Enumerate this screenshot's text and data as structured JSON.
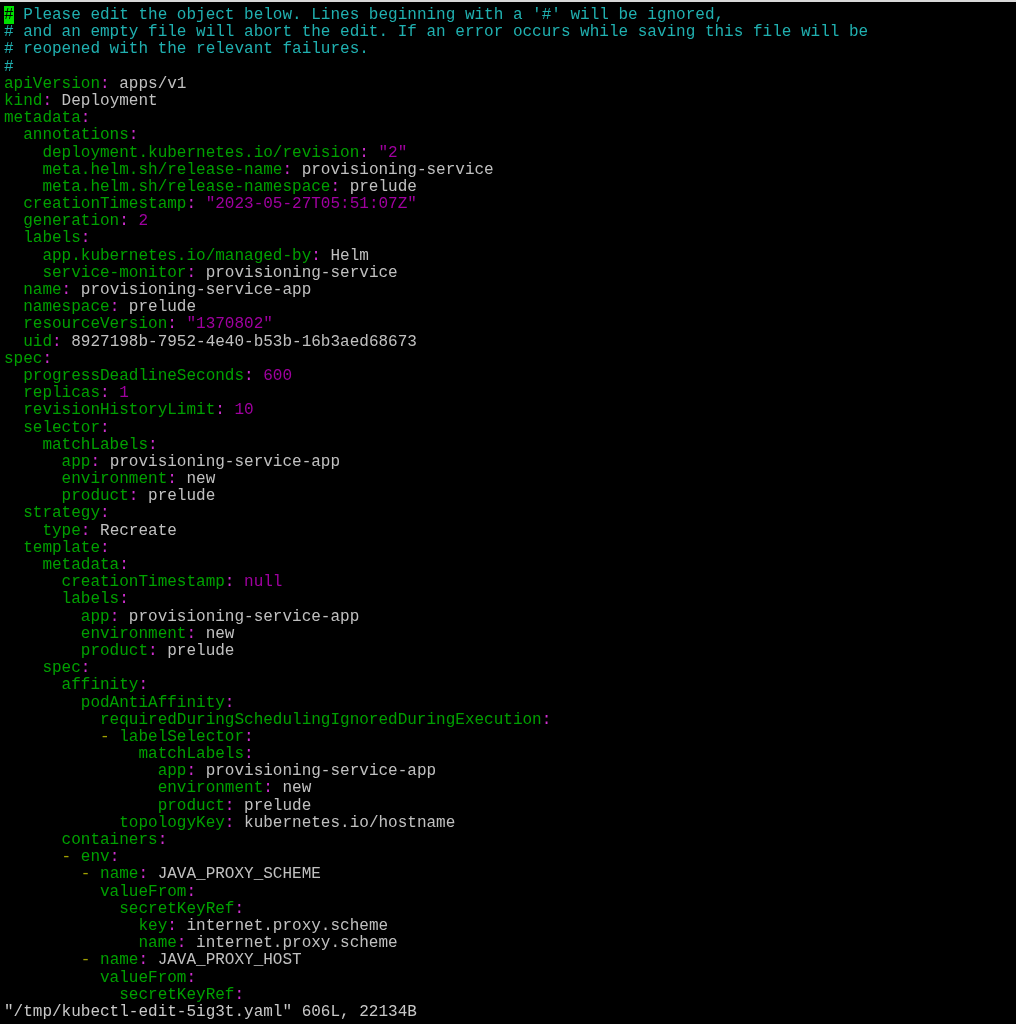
{
  "editor": {
    "lines": [
      {
        "parts": [
          {
            "kind": "cursor",
            "text": "#"
          },
          {
            "kind": "comment",
            "text": " Please edit the object below. Lines beginning with a '#' will be ignored,"
          }
        ]
      },
      {
        "parts": [
          {
            "kind": "comment",
            "text": "# and an empty file will abort the edit. If an error occurs while saving this file will be"
          }
        ]
      },
      {
        "parts": [
          {
            "kind": "comment",
            "text": "# reopened with the relevant failures."
          }
        ]
      },
      {
        "parts": [
          {
            "kind": "comment",
            "text": "#"
          }
        ]
      },
      {
        "parts": [
          {
            "kind": "key",
            "text": "apiVersion"
          },
          {
            "kind": "punct",
            "text": ":"
          },
          {
            "kind": "value",
            "text": " apps/v1"
          }
        ]
      },
      {
        "parts": [
          {
            "kind": "key",
            "text": "kind"
          },
          {
            "kind": "punct",
            "text": ":"
          },
          {
            "kind": "value",
            "text": " Deployment"
          }
        ]
      },
      {
        "parts": [
          {
            "kind": "key",
            "text": "metadata"
          },
          {
            "kind": "punct",
            "text": ":"
          }
        ]
      },
      {
        "parts": [
          {
            "kind": "key",
            "text": "  annotations"
          },
          {
            "kind": "punct",
            "text": ":"
          }
        ]
      },
      {
        "parts": [
          {
            "kind": "key",
            "text": "    deployment.kubernetes.io/revision"
          },
          {
            "kind": "punct",
            "text": ":"
          },
          {
            "kind": "literal",
            "text": " \"2\""
          }
        ]
      },
      {
        "parts": [
          {
            "kind": "key",
            "text": "    meta.helm.sh/release-name"
          },
          {
            "kind": "punct",
            "text": ":"
          },
          {
            "kind": "value",
            "text": " provisioning-service"
          }
        ]
      },
      {
        "parts": [
          {
            "kind": "key",
            "text": "    meta.helm.sh/release-namespace"
          },
          {
            "kind": "punct",
            "text": ":"
          },
          {
            "kind": "value",
            "text": " prelude"
          }
        ]
      },
      {
        "parts": [
          {
            "kind": "key",
            "text": "  creationTimestamp"
          },
          {
            "kind": "punct",
            "text": ":"
          },
          {
            "kind": "literal",
            "text": " \"2023-05-27T05:51:07Z\""
          }
        ]
      },
      {
        "parts": [
          {
            "kind": "key",
            "text": "  generation"
          },
          {
            "kind": "punct",
            "text": ":"
          },
          {
            "kind": "literal",
            "text": " 2"
          }
        ]
      },
      {
        "parts": [
          {
            "kind": "key",
            "text": "  labels"
          },
          {
            "kind": "punct",
            "text": ":"
          }
        ]
      },
      {
        "parts": [
          {
            "kind": "key",
            "text": "    app.kubernetes.io/managed-by"
          },
          {
            "kind": "punct",
            "text": ":"
          },
          {
            "kind": "value",
            "text": " Helm"
          }
        ]
      },
      {
        "parts": [
          {
            "kind": "key",
            "text": "    service-monitor"
          },
          {
            "kind": "punct",
            "text": ":"
          },
          {
            "kind": "value",
            "text": " provisioning-service"
          }
        ]
      },
      {
        "parts": [
          {
            "kind": "key",
            "text": "  name"
          },
          {
            "kind": "punct",
            "text": ":"
          },
          {
            "kind": "value",
            "text": " provisioning-service-app"
          }
        ]
      },
      {
        "parts": [
          {
            "kind": "key",
            "text": "  namespace"
          },
          {
            "kind": "punct",
            "text": ":"
          },
          {
            "kind": "value",
            "text": " prelude"
          }
        ]
      },
      {
        "parts": [
          {
            "kind": "key",
            "text": "  resourceVersion"
          },
          {
            "kind": "punct",
            "text": ":"
          },
          {
            "kind": "literal",
            "text": " \"1370802\""
          }
        ]
      },
      {
        "parts": [
          {
            "kind": "key",
            "text": "  uid"
          },
          {
            "kind": "punct",
            "text": ":"
          },
          {
            "kind": "value",
            "text": " 8927198b-7952-4e40-b53b-16b3aed68673"
          }
        ]
      },
      {
        "parts": [
          {
            "kind": "key",
            "text": "spec"
          },
          {
            "kind": "punct",
            "text": ":"
          }
        ]
      },
      {
        "parts": [
          {
            "kind": "key",
            "text": "  progressDeadlineSeconds"
          },
          {
            "kind": "punct",
            "text": ":"
          },
          {
            "kind": "literal",
            "text": " 600"
          }
        ]
      },
      {
        "parts": [
          {
            "kind": "key",
            "text": "  replicas"
          },
          {
            "kind": "punct",
            "text": ":"
          },
          {
            "kind": "literal",
            "text": " 1"
          }
        ]
      },
      {
        "parts": [
          {
            "kind": "key",
            "text": "  revisionHistoryLimit"
          },
          {
            "kind": "punct",
            "text": ":"
          },
          {
            "kind": "literal",
            "text": " 10"
          }
        ]
      },
      {
        "parts": [
          {
            "kind": "key",
            "text": "  selector"
          },
          {
            "kind": "punct",
            "text": ":"
          }
        ]
      },
      {
        "parts": [
          {
            "kind": "key",
            "text": "    matchLabels"
          },
          {
            "kind": "punct",
            "text": ":"
          }
        ]
      },
      {
        "parts": [
          {
            "kind": "key",
            "text": "      app"
          },
          {
            "kind": "punct",
            "text": ":"
          },
          {
            "kind": "value",
            "text": " provisioning-service-app"
          }
        ]
      },
      {
        "parts": [
          {
            "kind": "key",
            "text": "      environment"
          },
          {
            "kind": "punct",
            "text": ":"
          },
          {
            "kind": "value",
            "text": " new"
          }
        ]
      },
      {
        "parts": [
          {
            "kind": "key",
            "text": "      product"
          },
          {
            "kind": "punct",
            "text": ":"
          },
          {
            "kind": "value",
            "text": " prelude"
          }
        ]
      },
      {
        "parts": [
          {
            "kind": "key",
            "text": "  strategy"
          },
          {
            "kind": "punct",
            "text": ":"
          }
        ]
      },
      {
        "parts": [
          {
            "kind": "key",
            "text": "    type"
          },
          {
            "kind": "punct",
            "text": ":"
          },
          {
            "kind": "value",
            "text": " Recreate"
          }
        ]
      },
      {
        "parts": [
          {
            "kind": "key",
            "text": "  template"
          },
          {
            "kind": "punct",
            "text": ":"
          }
        ]
      },
      {
        "parts": [
          {
            "kind": "key",
            "text": "    metadata"
          },
          {
            "kind": "punct",
            "text": ":"
          }
        ]
      },
      {
        "parts": [
          {
            "kind": "key",
            "text": "      creationTimestamp"
          },
          {
            "kind": "punct",
            "text": ":"
          },
          {
            "kind": "literal",
            "text": " null"
          }
        ]
      },
      {
        "parts": [
          {
            "kind": "key",
            "text": "      labels"
          },
          {
            "kind": "punct",
            "text": ":"
          }
        ]
      },
      {
        "parts": [
          {
            "kind": "key",
            "text": "        app"
          },
          {
            "kind": "punct",
            "text": ":"
          },
          {
            "kind": "value",
            "text": " provisioning-service-app"
          }
        ]
      },
      {
        "parts": [
          {
            "kind": "key",
            "text": "        environment"
          },
          {
            "kind": "punct",
            "text": ":"
          },
          {
            "kind": "value",
            "text": " new"
          }
        ]
      },
      {
        "parts": [
          {
            "kind": "key",
            "text": "        product"
          },
          {
            "kind": "punct",
            "text": ":"
          },
          {
            "kind": "value",
            "text": " prelude"
          }
        ]
      },
      {
        "parts": [
          {
            "kind": "key",
            "text": "    spec"
          },
          {
            "kind": "punct",
            "text": ":"
          }
        ]
      },
      {
        "parts": [
          {
            "kind": "key",
            "text": "      affinity"
          },
          {
            "kind": "punct",
            "text": ":"
          }
        ]
      },
      {
        "parts": [
          {
            "kind": "key",
            "text": "        podAntiAffinity"
          },
          {
            "kind": "punct",
            "text": ":"
          }
        ]
      },
      {
        "parts": [
          {
            "kind": "key",
            "text": "          requiredDuringSchedulingIgnoredDuringExecution"
          },
          {
            "kind": "punct",
            "text": ":"
          }
        ]
      },
      {
        "parts": [
          {
            "kind": "dash",
            "text": "          -"
          },
          {
            "kind": "key",
            "text": " labelSelector"
          },
          {
            "kind": "punct",
            "text": ":"
          }
        ]
      },
      {
        "parts": [
          {
            "kind": "key",
            "text": "              matchLabels"
          },
          {
            "kind": "punct",
            "text": ":"
          }
        ]
      },
      {
        "parts": [
          {
            "kind": "key",
            "text": "                app"
          },
          {
            "kind": "punct",
            "text": ":"
          },
          {
            "kind": "value",
            "text": " provisioning-service-app"
          }
        ]
      },
      {
        "parts": [
          {
            "kind": "key",
            "text": "                environment"
          },
          {
            "kind": "punct",
            "text": ":"
          },
          {
            "kind": "value",
            "text": " new"
          }
        ]
      },
      {
        "parts": [
          {
            "kind": "key",
            "text": "                product"
          },
          {
            "kind": "punct",
            "text": ":"
          },
          {
            "kind": "value",
            "text": " prelude"
          }
        ]
      },
      {
        "parts": [
          {
            "kind": "key",
            "text": "            topologyKey"
          },
          {
            "kind": "punct",
            "text": ":"
          },
          {
            "kind": "value",
            "text": " kubernetes.io/hostname"
          }
        ]
      },
      {
        "parts": [
          {
            "kind": "key",
            "text": "      containers"
          },
          {
            "kind": "punct",
            "text": ":"
          }
        ]
      },
      {
        "parts": [
          {
            "kind": "dash",
            "text": "      -"
          },
          {
            "kind": "key",
            "text": " env"
          },
          {
            "kind": "punct",
            "text": ":"
          }
        ]
      },
      {
        "parts": [
          {
            "kind": "dash",
            "text": "        -"
          },
          {
            "kind": "key",
            "text": " name"
          },
          {
            "kind": "punct",
            "text": ":"
          },
          {
            "kind": "value",
            "text": " JAVA_PROXY_SCHEME"
          }
        ]
      },
      {
        "parts": [
          {
            "kind": "key",
            "text": "          valueFrom"
          },
          {
            "kind": "punct",
            "text": ":"
          }
        ]
      },
      {
        "parts": [
          {
            "kind": "key",
            "text": "            secretKeyRef"
          },
          {
            "kind": "punct",
            "text": ":"
          }
        ]
      },
      {
        "parts": [
          {
            "kind": "key",
            "text": "              key"
          },
          {
            "kind": "punct",
            "text": ":"
          },
          {
            "kind": "value",
            "text": " internet.proxy.scheme"
          }
        ]
      },
      {
        "parts": [
          {
            "kind": "key",
            "text": "              name"
          },
          {
            "kind": "punct",
            "text": ":"
          },
          {
            "kind": "value",
            "text": " internet.proxy.scheme"
          }
        ]
      },
      {
        "parts": [
          {
            "kind": "dash",
            "text": "        -"
          },
          {
            "kind": "key",
            "text": " name"
          },
          {
            "kind": "punct",
            "text": ":"
          },
          {
            "kind": "value",
            "text": " JAVA_PROXY_HOST"
          }
        ]
      },
      {
        "parts": [
          {
            "kind": "key",
            "text": "          valueFrom"
          },
          {
            "kind": "punct",
            "text": ":"
          }
        ]
      },
      {
        "parts": [
          {
            "kind": "key",
            "text": "            secretKeyRef"
          },
          {
            "kind": "punct",
            "text": ":"
          }
        ]
      }
    ]
  },
  "status_bar": {
    "message": "\"/tmp/kubectl-edit-5ig3t.yaml\" 606L, 22134B"
  }
}
